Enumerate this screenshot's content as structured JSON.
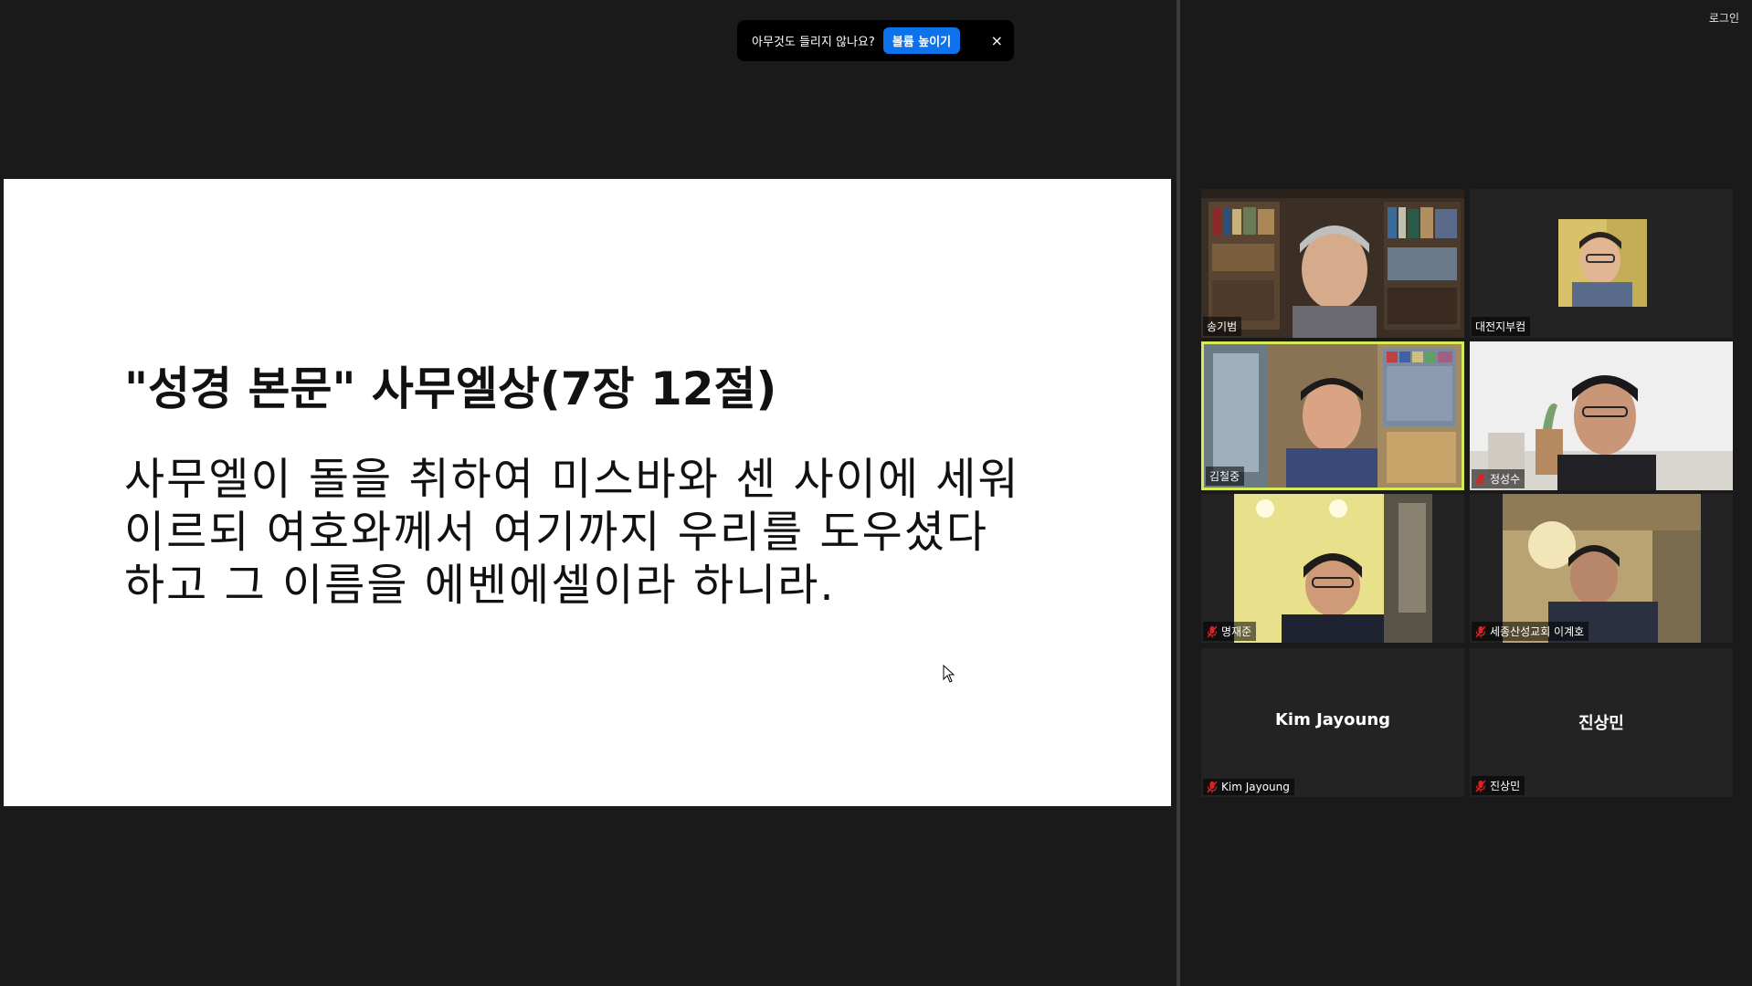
{
  "toast": {
    "message": "아무것도 들리지 않나요?",
    "action_label": "볼륨 높이기",
    "close_glyph": "×"
  },
  "header": {
    "login_label": "로그인"
  },
  "slide": {
    "title": "\"성경 본문\" 사무엘상(7장 12절)",
    "lines": [
      "사무엘이 돌을 취하여 미스바와 센 사이에 세워",
      "이르되 여호와께서 여기까지 우리를 도우셨다",
      "하고 그 이름을 에벤에셀이라 하니라."
    ]
  },
  "participants": [
    {
      "name": "송기범",
      "muted": false,
      "video": true,
      "active": false
    },
    {
      "name": "대전지부컴",
      "muted": false,
      "video": true,
      "active": false
    },
    {
      "name": "김철중",
      "muted": false,
      "video": true,
      "active": true
    },
    {
      "name": "정성수",
      "muted": true,
      "video": true,
      "active": false
    },
    {
      "name": "명재준",
      "muted": true,
      "video": true,
      "active": false
    },
    {
      "name": "세종산성교회 이계호",
      "muted": true,
      "video": true,
      "active": false
    },
    {
      "name": "Kim Jayoung",
      "muted": true,
      "video": false,
      "active": false
    },
    {
      "name": "진상민",
      "muted": true,
      "video": false,
      "active": false
    }
  ],
  "colors": {
    "background": "#1a1a1a",
    "accent": "#0e72ed",
    "active_speaker": "#d8e957",
    "muted_icon": "#e02020"
  }
}
